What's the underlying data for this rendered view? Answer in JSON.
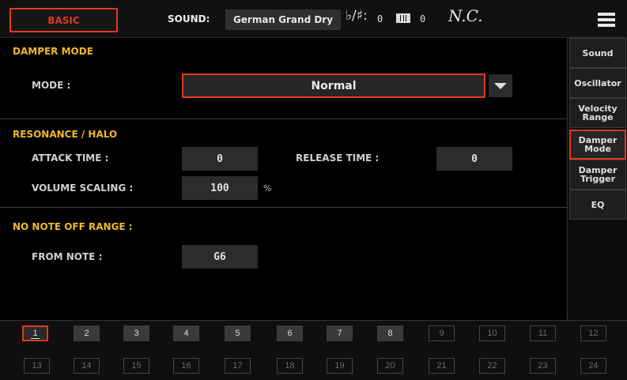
{
  "header": {
    "mode_button": "BASIC",
    "sound_label": "SOUND:",
    "sound_name": "German Grand Dry",
    "flat_sharp_symbol": "♭/♯:",
    "transpose_value": "0",
    "octave_value": "0",
    "chord": "N.C."
  },
  "damper_mode": {
    "title": "DAMPER MODE",
    "mode_label": "MODE :",
    "mode_value": "Normal"
  },
  "resonance": {
    "title": "RESONANCE / HALO",
    "attack_label": "ATTACK TIME :",
    "attack_value": "0",
    "release_label": "RELEASE TIME :",
    "release_value": "0",
    "volume_label": "VOLUME SCALING :",
    "volume_value": "100",
    "volume_unit": "%"
  },
  "no_note_off": {
    "title": "NO NOTE OFF RANGE :",
    "from_label": "FROM NOTE :",
    "from_value": "G6"
  },
  "side_tabs": {
    "sound": "Sound",
    "oscillator": "Oscillator",
    "velocity_range": "Velocity Range",
    "damper_mode": "Damper Mode",
    "damper_trigger": "Damper Trigger",
    "eq": "EQ"
  },
  "tracks": [
    "1",
    "2",
    "3",
    "4",
    "5",
    "6",
    "7",
    "8",
    "9",
    "10",
    "11",
    "12",
    "13",
    "14",
    "15",
    "16",
    "17",
    "18",
    "19",
    "20",
    "21",
    "22",
    "23",
    "24"
  ],
  "selected_track": "1",
  "colors": {
    "accent": "#e03a1e",
    "section_title": "#f1b928"
  }
}
